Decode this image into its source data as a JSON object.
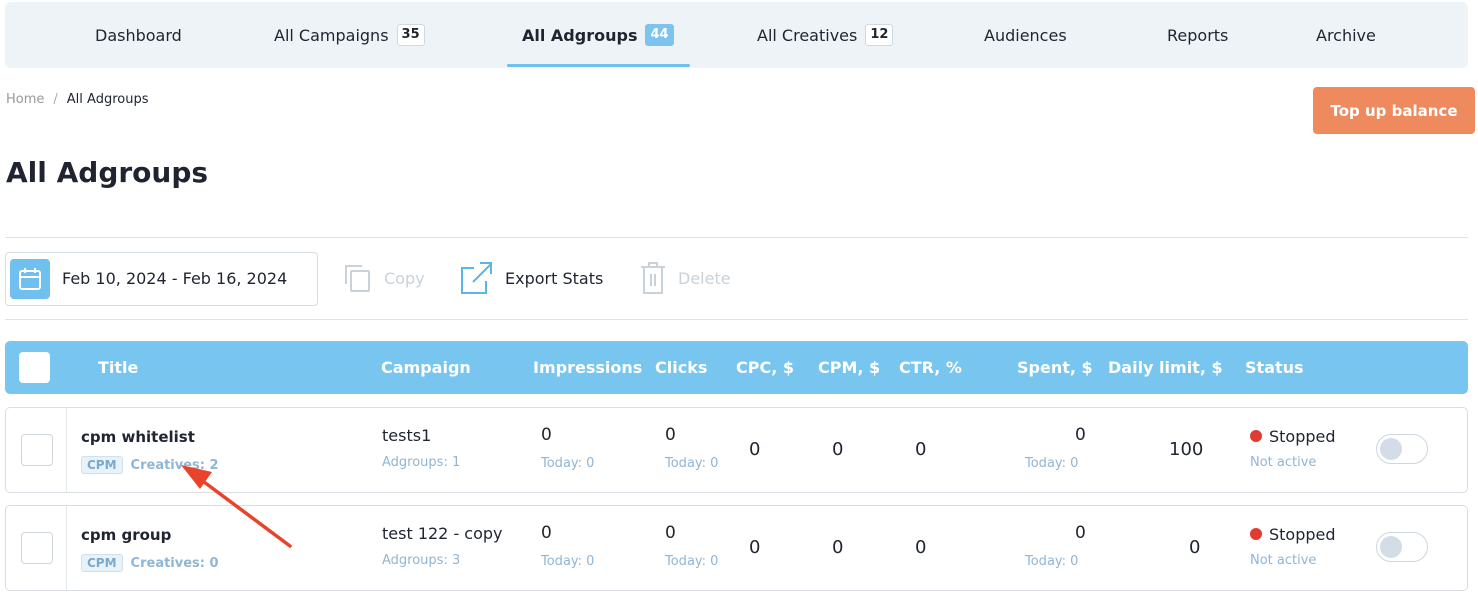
{
  "nav": {
    "items": [
      {
        "label": "Dashboard",
        "badge": null,
        "active": false
      },
      {
        "label": "All Campaigns",
        "badge": "35",
        "active": false
      },
      {
        "label": "All Adgroups",
        "badge": "44",
        "active": true
      },
      {
        "label": "All Creatives",
        "badge": "12",
        "active": false
      },
      {
        "label": "Audiences",
        "badge": null,
        "active": false
      },
      {
        "label": "Reports",
        "badge": null,
        "active": false
      },
      {
        "label": "Archive",
        "badge": null,
        "active": false
      }
    ]
  },
  "breadcrumb": {
    "home": "Home",
    "separator": "/",
    "current": "All Adgroups"
  },
  "actions": {
    "top_up_label": "Top up balance"
  },
  "page": {
    "title": "All Adgroups"
  },
  "toolbar": {
    "date_range": "Feb 10, 2024 - Feb 16, 2024",
    "copy_label": "Copy",
    "export_label": "Export Stats",
    "delete_label": "Delete"
  },
  "table": {
    "columns": [
      "Title",
      "Campaign",
      "Impressions",
      "Clicks",
      "CPC, $",
      "CPM, $",
      "CTR, %",
      "Spent, $",
      "Daily limit, $",
      "Status"
    ],
    "rows": [
      {
        "title": "cpm whitelist",
        "tag": "CPM",
        "creatives": "Creatives: 2",
        "campaign": "tests1",
        "adgroups": "Adgroups: 1",
        "impressions": "0",
        "impressions_today": "Today: 0",
        "clicks": "0",
        "clicks_today": "Today: 0",
        "cpc": "0",
        "cpm": "0",
        "ctr": "0",
        "spent": "0",
        "spent_today": "Today: 0",
        "daily_limit": "100",
        "status": "Stopped",
        "status_sub": "Not active"
      },
      {
        "title": "cpm group",
        "tag": "CPM",
        "creatives": "Creatives: 0",
        "campaign": "test 122 - copy",
        "adgroups": "Adgroups: 3",
        "impressions": "0",
        "impressions_today": "Today: 0",
        "clicks": "0",
        "clicks_today": "Today: 0",
        "cpc": "0",
        "cpm": "0",
        "ctr": "0",
        "spent": "0",
        "spent_today": "Today: 0",
        "daily_limit": "0",
        "status": "Stopped",
        "status_sub": "Not active"
      }
    ]
  },
  "colors": {
    "accent": "#78c5ef",
    "topup": "#ef8a5f",
    "status_stopped": "#e03a32",
    "annotation_arrow": "#e8432b"
  },
  "icons": [
    "calendar-icon",
    "copy-icon",
    "export-icon",
    "trash-icon"
  ]
}
